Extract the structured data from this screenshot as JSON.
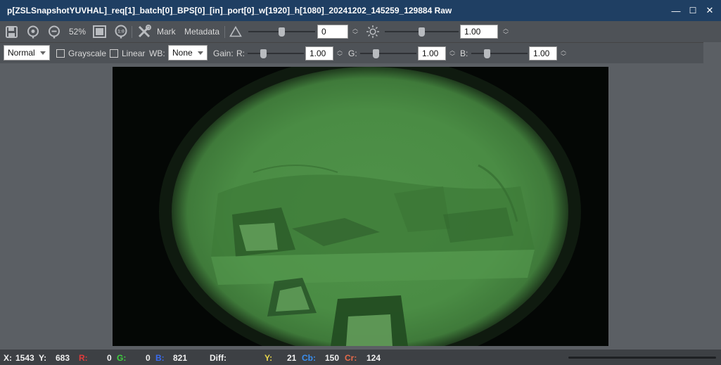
{
  "window": {
    "title": "p[ZSLSnapshotYUVHAL]_req[1]_batch[0]_BPS[0]_[in]_port[0]_w[1920]_h[1080]_20241202_145259_129884 Raw",
    "minimize_glyph": "—",
    "maximize_glyph": "☐",
    "close_glyph": "✕"
  },
  "toolbar1": {
    "zoom_percent": "52%",
    "actual_size_label": "1:0",
    "mark_label": "Mark",
    "metadata_label": "Metadata",
    "contrast_value": "0",
    "contrast_level": 0.5,
    "brightness_value": "1.00",
    "brightness_level": 0.5
  },
  "toolbar2": {
    "mode_select": "Normal",
    "grayscale_label": "Grayscale",
    "linear_label": "Linear",
    "wb_label": "WB:",
    "wb_select": "None",
    "gain_label": "Gain:",
    "r_label": "R:",
    "r_value": "1.00",
    "r_level": 0.25,
    "g_label": "G:",
    "g_value": "1.00",
    "g_level": 0.25,
    "b_label": "B:",
    "b_value": "1.00",
    "b_level": 0.25
  },
  "status": {
    "x_label": "X:",
    "x_value": "1543",
    "y_label": "Y:",
    "y_value": "683",
    "r_label": "R:",
    "r_value": "0",
    "g_label": "G:",
    "g_value": "0",
    "b_label": "B:",
    "b_value": "821",
    "diff_label": "Diff:",
    "yy_label": "Y:",
    "yy_value": "21",
    "cb_label": "Cb:",
    "cb_value": "150",
    "cr_label": "Cr:",
    "cr_value": "124"
  },
  "colors": {
    "titlebar": "#1f3f63",
    "image_green": "#4a8a44",
    "status_r": "#e03b3b",
    "status_g": "#3fd13f",
    "status_b": "#3a6cf0",
    "status_y": "#e8d64a",
    "status_cb": "#3a8ff0",
    "status_cr": "#e86a4a"
  },
  "icons": {
    "save": "save-icon",
    "zoom_in": "zoom-in-icon",
    "zoom_out": "zoom-out-icon",
    "fit": "fit-window-icon",
    "actual_size": "actual-size-icon",
    "tools": "tools-icon",
    "contrast": "contrast-triangle-icon",
    "brightness": "brightness-sun-icon"
  }
}
